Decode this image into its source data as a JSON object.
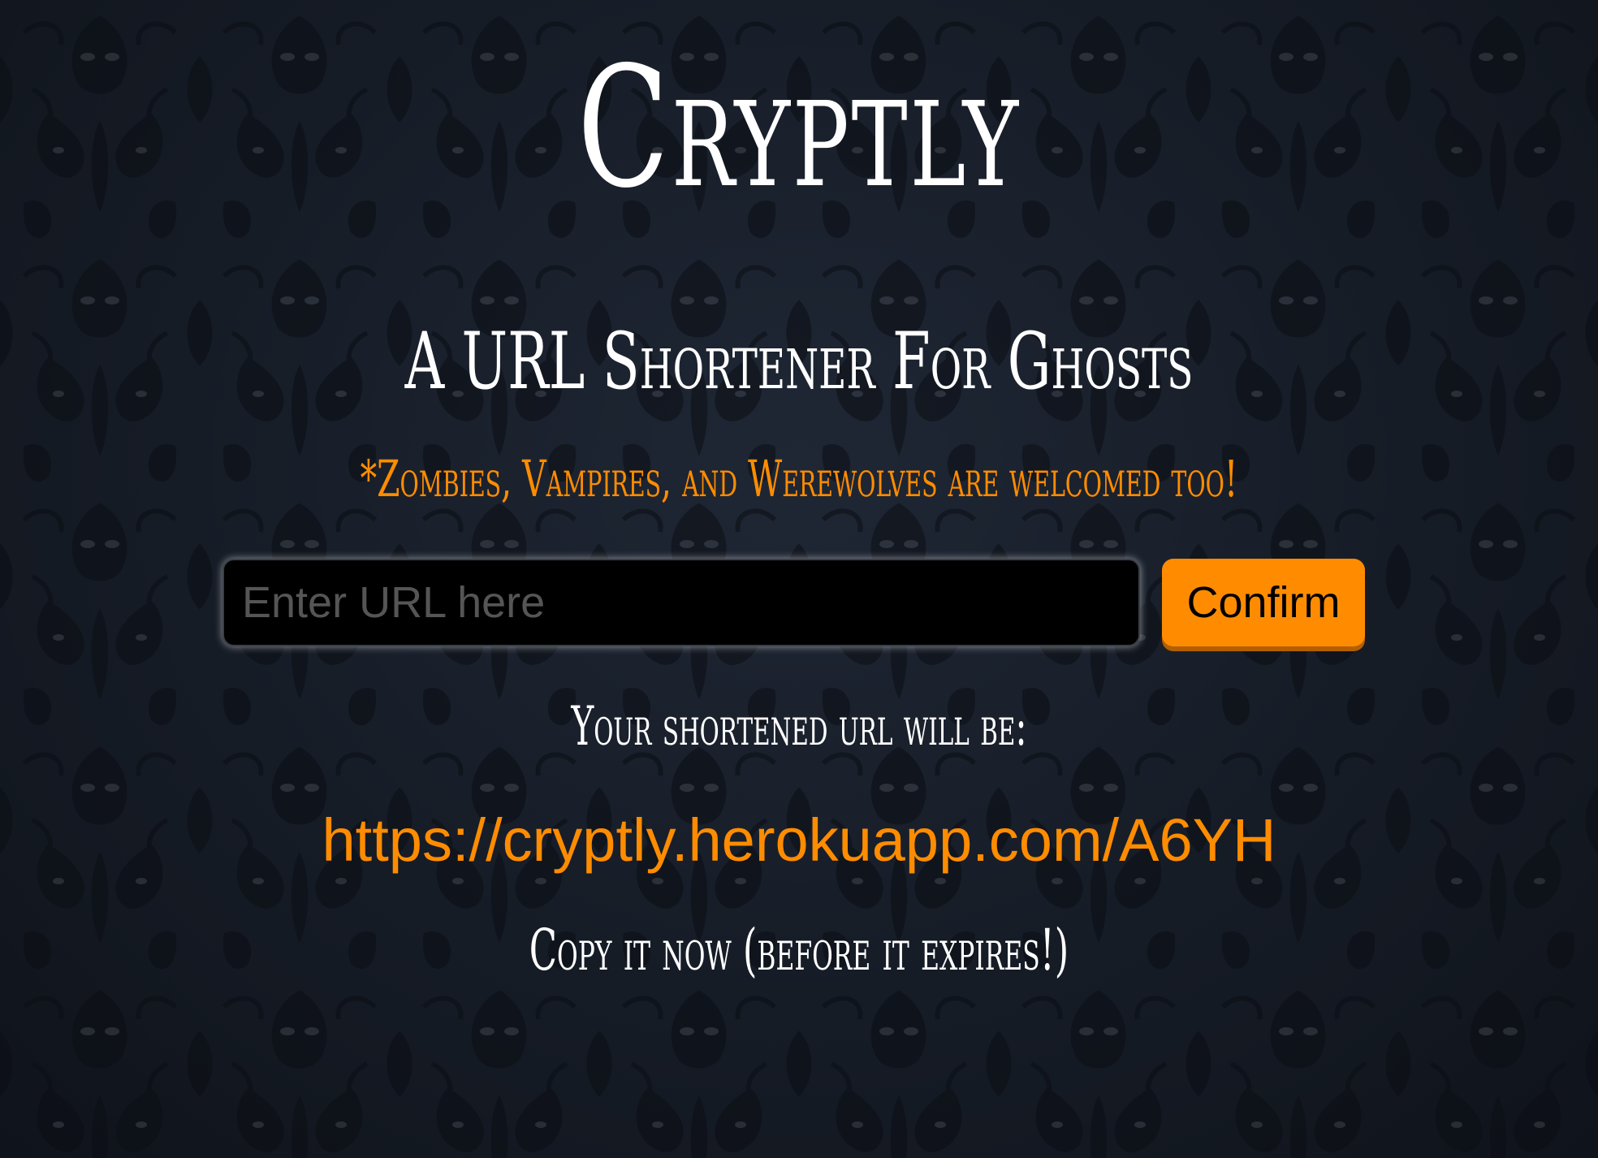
{
  "header": {
    "title": "Cryptly",
    "subtitle": "A URL Shortener For Ghosts",
    "tagline": "*Zombies, Vampires, and Werewolves are welcomed too!"
  },
  "form": {
    "url_placeholder": "Enter URL here",
    "url_value": "",
    "confirm_label": "Confirm"
  },
  "result": {
    "label": "Your shortened url will be:",
    "short_url": "https://cryptly.herokuapp.com/A6YH",
    "note": "Copy it now (before it expires!)"
  },
  "colors": {
    "accent": "#ff8c00",
    "background": "#161c26",
    "text": "#ffffff",
    "input_bg": "#000000"
  },
  "icons": {
    "background": "haunted-damask-wallpaper-pattern"
  }
}
